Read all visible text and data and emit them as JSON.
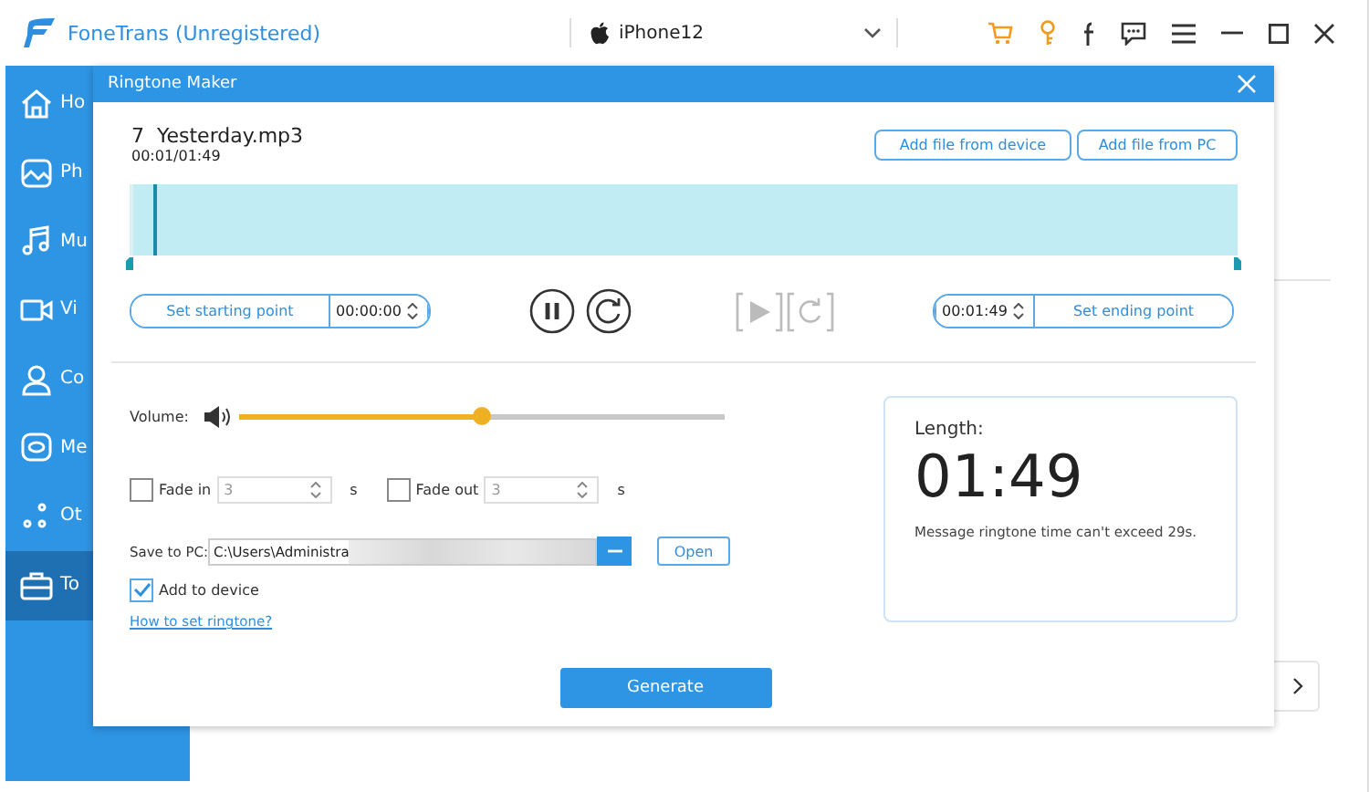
{
  "app": {
    "title": "FoneTrans (Unregistered)",
    "device": "iPhone12"
  },
  "sidebar": {
    "items": [
      {
        "label": "Ho",
        "selected": false
      },
      {
        "label": "Ph",
        "selected": false
      },
      {
        "label": "Mu",
        "selected": false
      },
      {
        "label": "Vi",
        "selected": false
      },
      {
        "label": "Co",
        "selected": false
      },
      {
        "label": "Me",
        "selected": false
      },
      {
        "label": "Ot",
        "selected": false
      },
      {
        "label": "To",
        "selected": true
      }
    ]
  },
  "dialog": {
    "title": "Ringtone Maker",
    "file_name": "7  Yesterday.mp3",
    "progress": "00:01/01:49",
    "add_buttons": [
      "Add file from device",
      "Add file from PC"
    ],
    "playhead": {
      "level": 0.012
    },
    "start": {
      "button": "Set starting point",
      "value": "00:00:00"
    },
    "end": {
      "button": "Set ending point",
      "value": "00:01:49"
    },
    "volume": {
      "label": "Volume:",
      "level": 0.5
    },
    "fade_in": {
      "label": "Fade in",
      "checked": false,
      "value": "3",
      "unit": "s"
    },
    "fade_out": {
      "label": "Fade out",
      "checked": false,
      "value": "3",
      "unit": "s"
    },
    "save": {
      "label": "Save to PC:",
      "value": "C:\\Users\\Administra",
      "open": "Open"
    },
    "add_to_device": {
      "label": "Add to device",
      "checked": true
    },
    "help_link": "How to set ringtone?",
    "length": {
      "label": "Length:",
      "value": "01:49",
      "note": "Message ringtone time can't exceed 29s."
    },
    "generate": "Generate"
  }
}
